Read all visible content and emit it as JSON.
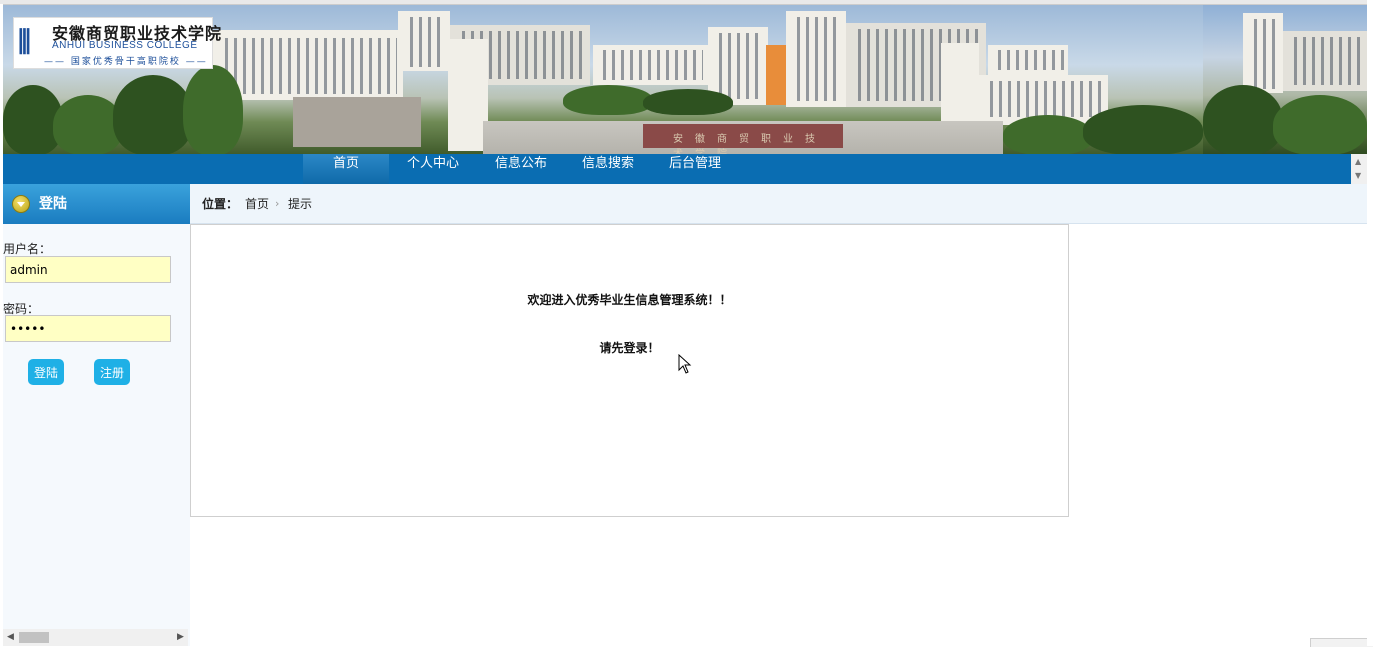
{
  "banner": {
    "logo": {
      "name_cn": "安徽商贸职业技术学院",
      "name_en": "ANHUI BUSINESS COLLEGE",
      "tagline": "—— 国家优秀骨干高职院校 ——"
    },
    "gate_text": "安徽商贸职业技术学院"
  },
  "nav": {
    "items": [
      {
        "label": "首页",
        "active": true
      },
      {
        "label": "个人中心",
        "active": false
      },
      {
        "label": "信息公布",
        "active": false
      },
      {
        "label": "信息搜索",
        "active": false
      },
      {
        "label": "后台管理",
        "active": false
      }
    ]
  },
  "sidebar": {
    "title": "登陆",
    "username_label": "用户名：",
    "username_value": "admin",
    "password_label": "密码：",
    "password_value": "admin",
    "login_button": "登陆",
    "register_button": "注册"
  },
  "breadcrumb": {
    "prefix": "位置：",
    "items": [
      "首页",
      "提示"
    ],
    "separator": "›"
  },
  "main": {
    "welcome": "欢迎进入优秀毕业生信息管理系统！！",
    "prompt": "请先登录！"
  },
  "colors": {
    "nav_bg": "#0a6db2",
    "sidebar_head": "#1a7cc0",
    "button": "#1fb0e6",
    "input_bg": "#ffffc4"
  }
}
